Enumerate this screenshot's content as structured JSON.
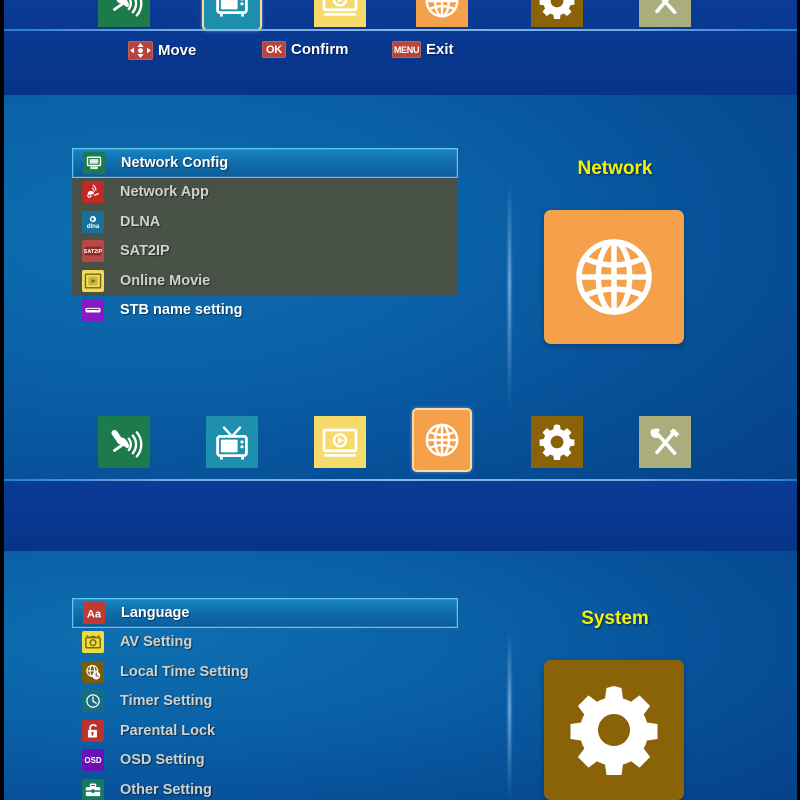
{
  "meta": {
    "accent_yellow": "#f3f308",
    "panel_blue": "#0a60a6",
    "band_blue": "#073a8f",
    "list_gray": "#4e503e",
    "select_cyan": "#5fc8f0",
    "key_red": "#b7453c"
  },
  "hints": {
    "move": {
      "key": "",
      "label": "Move",
      "icon": "dpad-icon"
    },
    "confirm": {
      "key": "OK",
      "label": "Confirm",
      "icon": "ok-key-icon"
    },
    "exit": {
      "key": "MENU",
      "label": "Exit",
      "icon": "menu-key-icon"
    }
  },
  "iconbar": {
    "items": [
      {
        "name": "installation",
        "icon": "satellite-dish-icon",
        "color": "#1d7a4a",
        "selected": false
      },
      {
        "name": "channel",
        "icon": "television-icon",
        "color": "#1f8fae",
        "selected": false
      },
      {
        "name": "media",
        "icon": "media-player-icon",
        "color": "#f7db6a",
        "selected": false
      },
      {
        "name": "network",
        "icon": "globe-icon",
        "color": "#f5a04a",
        "selected": false
      },
      {
        "name": "system",
        "icon": "gear-icon",
        "color": "#8a6308",
        "selected": false
      },
      {
        "name": "tools",
        "icon": "tools-icon",
        "color": "#a9ae7c",
        "selected": false
      }
    ]
  },
  "top_section": {
    "selected_index": 1
  },
  "network_section": {
    "preview_title": "Network",
    "preview_icon": "globe-icon",
    "preview_color": "#f5a04a",
    "selected_index": 3,
    "menu": {
      "items": [
        {
          "label": "Network Config",
          "icon": "network-config-icon",
          "icon_color": "#1d7a4a",
          "selected": true,
          "outside": false
        },
        {
          "label": "Network App",
          "icon": "network-app-icon",
          "icon_color": "#c02a24",
          "selected": false,
          "outside": false
        },
        {
          "label": "DLNA",
          "icon": "dlna-icon",
          "icon_color": "#1a6f98",
          "selected": false,
          "outside": false
        },
        {
          "label": "SAT2IP",
          "icon": "sat2ip-icon",
          "icon_color": "#b54a46",
          "selected": false,
          "outside": false
        },
        {
          "label": "Online Movie",
          "icon": "online-movie-icon",
          "icon_color": "#f2dc5d",
          "selected": false,
          "outside": false
        },
        {
          "label": "STB name setting",
          "icon": "stb-name-icon",
          "icon_color": "#8a18c8",
          "selected": false,
          "outside": true
        }
      ]
    }
  },
  "system_section": {
    "preview_title": "System",
    "preview_icon": "gear-icon",
    "preview_color": "#8a6308",
    "menu": {
      "items": [
        {
          "label": "Language",
          "icon": "language-icon",
          "icon_color": "#c03a34",
          "selected": true
        },
        {
          "label": "AV Setting",
          "icon": "av-setting-icon",
          "icon_color": "#ecdc3c",
          "selected": false
        },
        {
          "label": "Local Time Setting",
          "icon": "local-time-icon",
          "icon_color": "#7a5c0c",
          "selected": false
        },
        {
          "label": "Timer Setting",
          "icon": "timer-icon",
          "icon_color": "#176f7e",
          "selected": false
        },
        {
          "label": "Parental Lock",
          "icon": "lock-icon",
          "icon_color": "#c0302a",
          "selected": false
        },
        {
          "label": "OSD Setting",
          "icon": "osd-icon",
          "icon_color": "#6a12b8",
          "selected": false
        },
        {
          "label": "Other Setting",
          "icon": "other-setting-icon",
          "icon_color": "#14795e",
          "selected": false
        }
      ]
    }
  }
}
